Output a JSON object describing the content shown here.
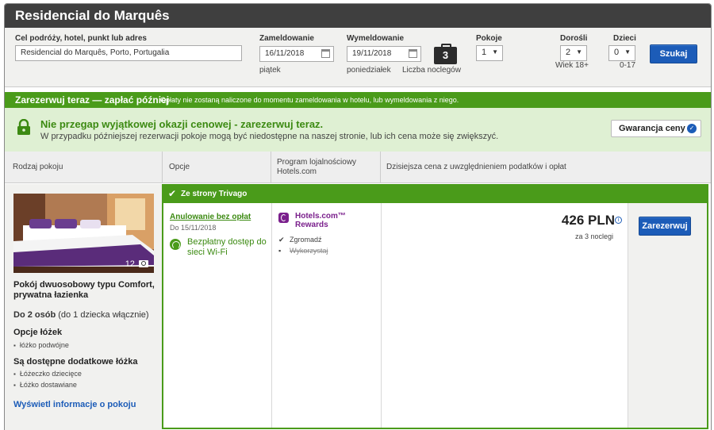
{
  "hotel": {
    "title": "Residencial do Marquês"
  },
  "search": {
    "destination_label": "Cel podróży, hotel, punkt lub adres",
    "destination_value": "Residencial do Marquês, Porto, Portugalia",
    "checkin_label": "Zameldowanie",
    "checkin_value": "16/11/2018",
    "checkin_day": "piątek",
    "checkout_label": "Wymeldowanie",
    "checkout_value": "19/11/2018",
    "checkout_day": "poniedziałek",
    "nights_value": "3",
    "nights_label": "Liczba noclegów",
    "rooms_label": "Pokoje",
    "rooms_value": "1",
    "adults_label": "Dorośli",
    "adults_value": "2",
    "adults_note": "Wiek 18+",
    "children_label": "Dzieci",
    "children_value": "0",
    "children_note": "0-17",
    "search_button": "Szukaj"
  },
  "promo": {
    "strong": "Zarezerwuj teraz — zapłać później",
    "note": "Opłaty nie zostaną naliczone do momentu zameldowania w hotelu, lub wymeldowania z niego."
  },
  "deal": {
    "headline": "Nie przegap wyjątkowej okazji cenowej - zarezerwuj teraz.",
    "text": "W przypadku późniejszej rezerwacji pokoje mogą być niedostępne na naszej stronie, lub ich cena może się zwiększyć.",
    "guarantee_button": "Gwarancja ceny"
  },
  "table_headers": {
    "room_type": "Rodzaj pokoju",
    "options": "Opcje",
    "loyalty_line1": "Program lojalnościowy",
    "loyalty_line2": "Hotels.com",
    "price": "Dzisiejsza cena z uwzględnieniem podatków i opłat"
  },
  "room": {
    "photo_count": "12",
    "name": "Pokój dwuosobowy typu Comfort, prywatna łazienka",
    "occupancy_bold": "Do 2 osób",
    "occupancy_rest": " (do 1 dziecka włącznie)",
    "bed_options_title": "Opcje łóżek",
    "bed_options": [
      "łóżko podwójne"
    ],
    "extra_beds_title": "Są dostępne dodatkowe łóżka",
    "extra_beds": [
      "Łóżeczko dziecięce",
      "Łóżko dostawiane"
    ],
    "info_link": "Wyświetl informacje o pokoju"
  },
  "offer": {
    "source": "Ze strony Trivago",
    "cancellation": "Anulowanie bez opłat",
    "cancellation_until": "Do 15/11/2018",
    "wifi": "Bezpłatny dostęp do sieci Wi-Fi",
    "loyalty_name": "Hotels.com™ Rewards",
    "collect": "Zgromadź",
    "redeem": "Wykorzystaj",
    "price": "426 PLN",
    "price_note": "za 3 noclegi",
    "book_button": "Zarezerwuj"
  },
  "colors": {
    "accent_green": "#4a9b1a",
    "brand_blue": "#1c5cb8",
    "loyalty_purple": "#7a1f8c",
    "header_dark": "#3f3f3f"
  }
}
